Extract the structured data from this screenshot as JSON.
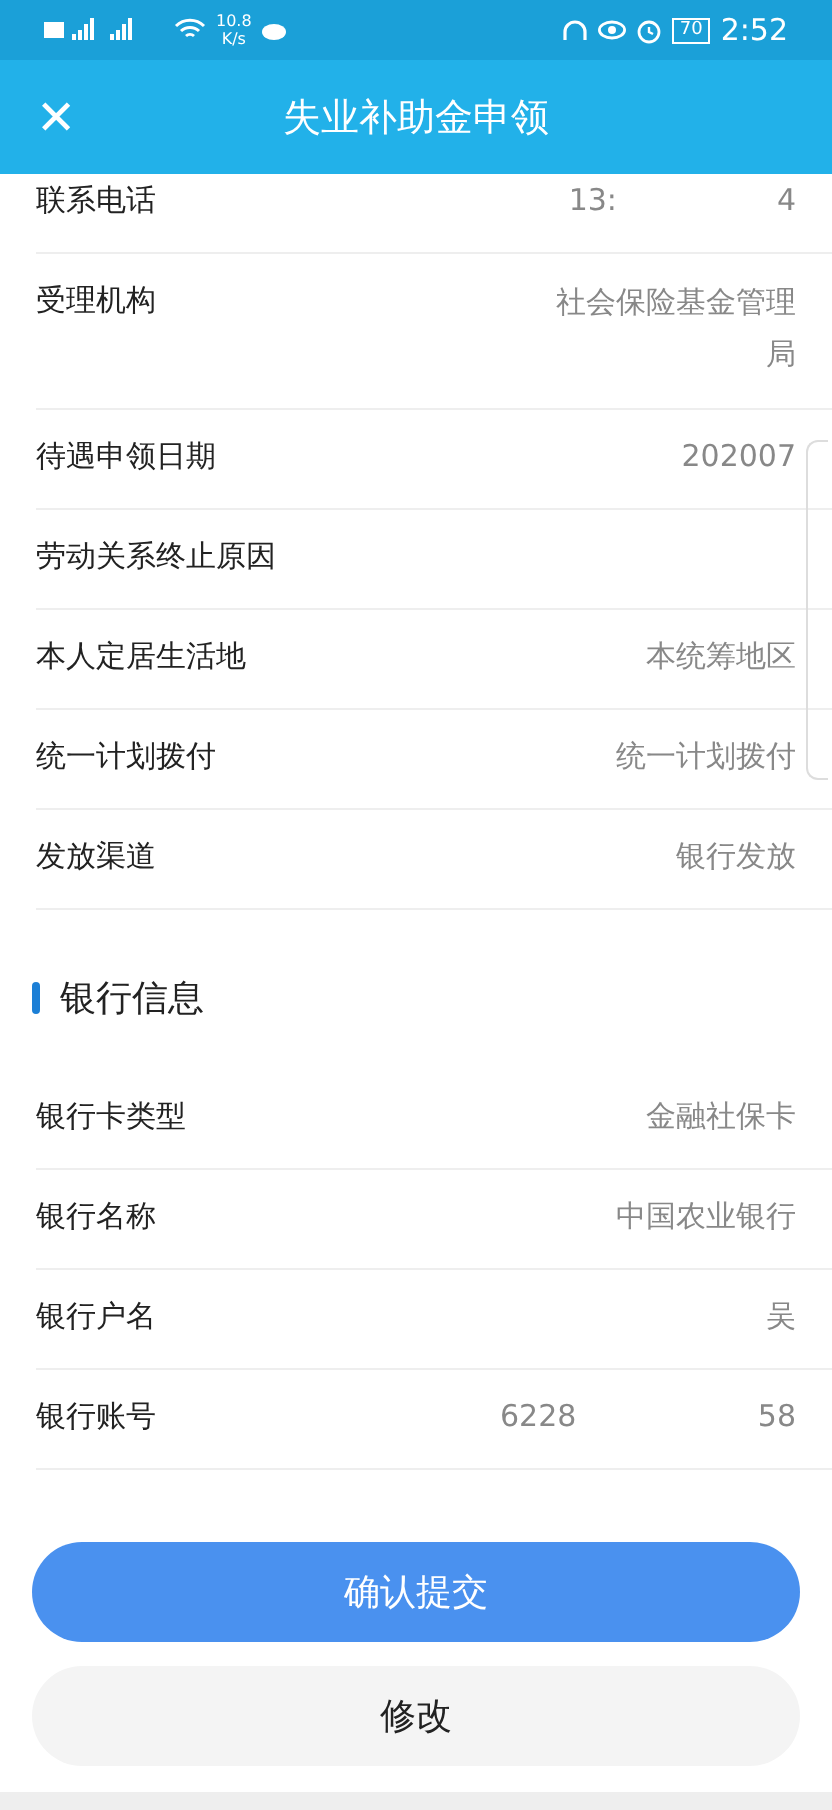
{
  "status_bar": {
    "network_speed": "10.8",
    "speed_unit": "K/s",
    "battery": "70",
    "time": "2:52"
  },
  "header": {
    "title": "失业补助金申领",
    "close": "✕"
  },
  "rows": [
    {
      "label": "联系电话",
      "values": [
        "13:",
        "4"
      ]
    },
    {
      "label": "受理机构",
      "values": [
        "社会保险基金管理局"
      ]
    },
    {
      "label": "待遇申领日期",
      "values": [
        "202007"
      ]
    },
    {
      "label": "劳动关系终止原因",
      "values": []
    },
    {
      "label": "本人定居生活地",
      "values": [
        "本统筹地区"
      ]
    },
    {
      "label": "统一计划拨付",
      "values": [
        "统一计划拨付"
      ]
    },
    {
      "label": "发放渠道",
      "values": [
        "银行发放"
      ]
    }
  ],
  "section": {
    "title": "银行信息"
  },
  "bank_rows": [
    {
      "label": "银行卡类型",
      "values": [
        "金融社保卡"
      ]
    },
    {
      "label": "银行名称",
      "values": [
        "中国农业银行"
      ]
    },
    {
      "label": "银行户名",
      "values": [
        "吴"
      ]
    },
    {
      "label": "银行账号",
      "values": [
        "6228",
        "58"
      ]
    }
  ],
  "buttons": {
    "confirm": "确认提交",
    "edit": "修改"
  }
}
